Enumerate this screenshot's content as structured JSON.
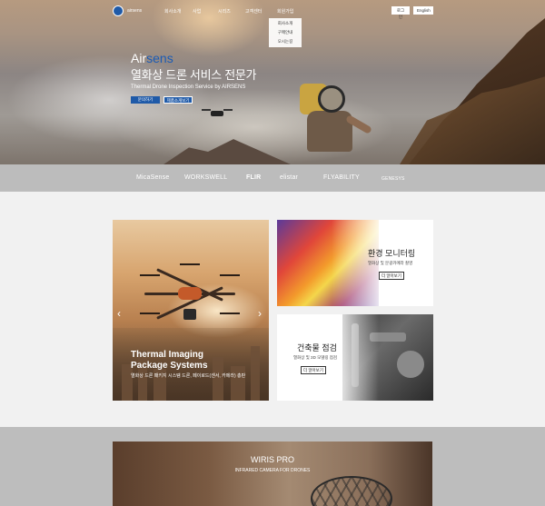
{
  "header": {
    "logo_text": "airsens",
    "menu": [
      "회사소개",
      "사업",
      "시리즈",
      "고객센터",
      "회원가입"
    ],
    "login_label": "로그인",
    "lang_label": "English",
    "dropdown": [
      "회사소개",
      "구매안내",
      "오시는길"
    ]
  },
  "hero": {
    "title_plain": "Air",
    "title_accent": "sens",
    "subtitle": "열화상 드론 서비스 전문가",
    "desc": "Thermal Drone Inspection Service by AIRSENS",
    "btn_primary": "문의하기",
    "btn_secondary": "제품소개보기"
  },
  "partners": [
    "MicaSense",
    "WORKSWELL",
    "FLIR",
    "elistar",
    "FLYABILITY",
    "GENESYS"
  ],
  "slider": {
    "title_line1": "Thermal Imaging",
    "title_line2": "Package Systems",
    "subtitle": "열화상 드론 패키지 시스템 드론, 페이로드(센서, 카메라) 총판",
    "prev_arrow": "‹",
    "next_arrow": "›"
  },
  "cards": [
    {
      "title": "환경 모니터링",
      "subtitle": "열화상 및 분광카메라 촬영",
      "button": "더 알아보기"
    },
    {
      "title": "건축물 점검",
      "subtitle": "열화상 및 3D 모델링 점검",
      "button": "더 알아보기"
    }
  ],
  "banner": {
    "title": "WIRIS PRO",
    "subtitle": "INFRARED CAMERA FOR DRONES"
  }
}
